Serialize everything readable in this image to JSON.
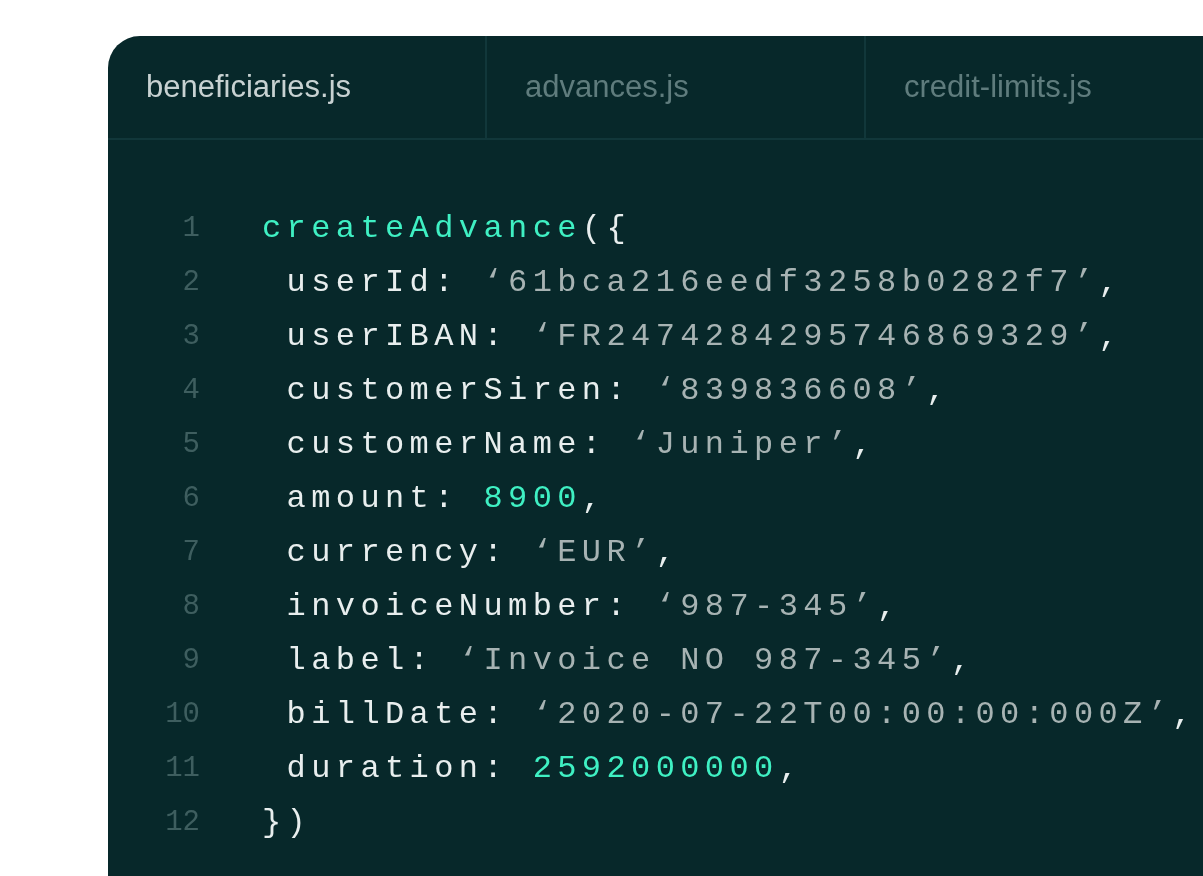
{
  "tabs": [
    {
      "label": "beneficiaries.js",
      "selected": true
    },
    {
      "label": "advances.js",
      "selected": false
    },
    {
      "label": "credit-limits.js",
      "selected": false
    }
  ],
  "code": [
    {
      "number": "1",
      "tokens": [
        {
          "kind": "function",
          "text": "createAdvance"
        },
        {
          "kind": "plain",
          "text": "({"
        }
      ]
    },
    {
      "number": "2",
      "tokens": [
        {
          "kind": "plain",
          "text": " userId: "
        },
        {
          "kind": "string",
          "text": "‘61bca216eedf3258b0282f7’"
        },
        {
          "kind": "plain",
          "text": ","
        }
      ]
    },
    {
      "number": "3",
      "tokens": [
        {
          "kind": "plain",
          "text": " userIBAN: "
        },
        {
          "kind": "string",
          "text": "‘FR2474284295746869329’"
        },
        {
          "kind": "plain",
          "text": ","
        }
      ]
    },
    {
      "number": "4",
      "tokens": [
        {
          "kind": "plain",
          "text": " customerSiren: "
        },
        {
          "kind": "string",
          "text": "‘839836608’"
        },
        {
          "kind": "plain",
          "text": ","
        }
      ]
    },
    {
      "number": "5",
      "tokens": [
        {
          "kind": "plain",
          "text": " customerName: "
        },
        {
          "kind": "string",
          "text": "‘Juniper’"
        },
        {
          "kind": "plain",
          "text": ","
        }
      ]
    },
    {
      "number": "6",
      "tokens": [
        {
          "kind": "plain",
          "text": " amount: "
        },
        {
          "kind": "number",
          "text": "8900"
        },
        {
          "kind": "plain",
          "text": ","
        }
      ]
    },
    {
      "number": "7",
      "tokens": [
        {
          "kind": "plain",
          "text": " currency: "
        },
        {
          "kind": "string",
          "text": "‘EUR’"
        },
        {
          "kind": "plain",
          "text": ","
        }
      ]
    },
    {
      "number": "8",
      "tokens": [
        {
          "kind": "plain",
          "text": " invoiceNumber: "
        },
        {
          "kind": "string",
          "text": "‘987-345’"
        },
        {
          "kind": "plain",
          "text": ","
        }
      ]
    },
    {
      "number": "9",
      "tokens": [
        {
          "kind": "plain",
          "text": " label: "
        },
        {
          "kind": "string",
          "text": "‘Invoice NO 987-345’"
        },
        {
          "kind": "plain",
          "text": ","
        }
      ]
    },
    {
      "number": "10",
      "tokens": [
        {
          "kind": "plain",
          "text": " billDate: "
        },
        {
          "kind": "string",
          "text": "‘2020-07-22T00:00:00:000Z’"
        },
        {
          "kind": "plain",
          "text": ","
        }
      ]
    },
    {
      "number": "11",
      "tokens": [
        {
          "kind": "plain",
          "text": " duration: "
        },
        {
          "kind": "number",
          "text": "2592000000"
        },
        {
          "kind": "plain",
          "text": ","
        }
      ]
    },
    {
      "number": "12",
      "tokens": [
        {
          "kind": "plain",
          "text": "})"
        }
      ]
    }
  ]
}
